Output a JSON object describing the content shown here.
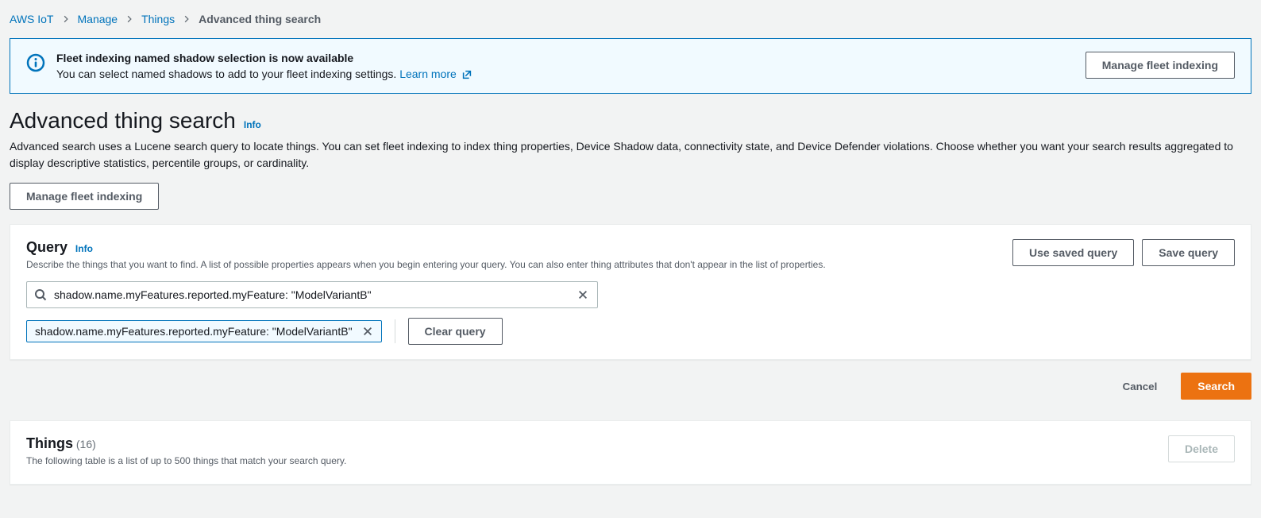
{
  "breadcrumbs": {
    "items": [
      {
        "label": "AWS IoT",
        "link": true
      },
      {
        "label": "Manage",
        "link": true
      },
      {
        "label": "Things",
        "link": true
      },
      {
        "label": "Advanced thing search",
        "link": false
      }
    ]
  },
  "info_banner": {
    "title": "Fleet indexing named shadow selection is now available",
    "description": "You can select named shadows to add to your fleet indexing settings.",
    "learn_more": "Learn more",
    "button": "Manage fleet indexing"
  },
  "page": {
    "title": "Advanced thing search",
    "info_label": "Info",
    "description": "Advanced search uses a Lucene search query to locate things. You can set fleet indexing to index thing properties, Device Shadow data, connectivity state, and Device Defender violations. Choose whether you want your search results aggregated to display descriptive statistics, percentile groups, or cardinality.",
    "manage_button": "Manage fleet indexing"
  },
  "query_panel": {
    "title": "Query",
    "info_label": "Info",
    "description": "Describe the things that you want to find. A list of possible properties appears when you begin entering your query. You can also enter thing attributes that don't appear in the list of properties.",
    "use_saved_button": "Use saved query",
    "save_button": "Save query",
    "input_value": "shadow.name.myFeatures.reported.myFeature: \"ModelVariantB\"",
    "token_label": "shadow.name.myFeatures.reported.myFeature: \"ModelVariantB\"",
    "clear_button": "Clear query"
  },
  "actions": {
    "cancel": "Cancel",
    "search": "Search"
  },
  "things_panel": {
    "title": "Things",
    "count": "(16)",
    "description": "The following table is a list of up to 500 things that match your search query.",
    "delete_button": "Delete"
  }
}
